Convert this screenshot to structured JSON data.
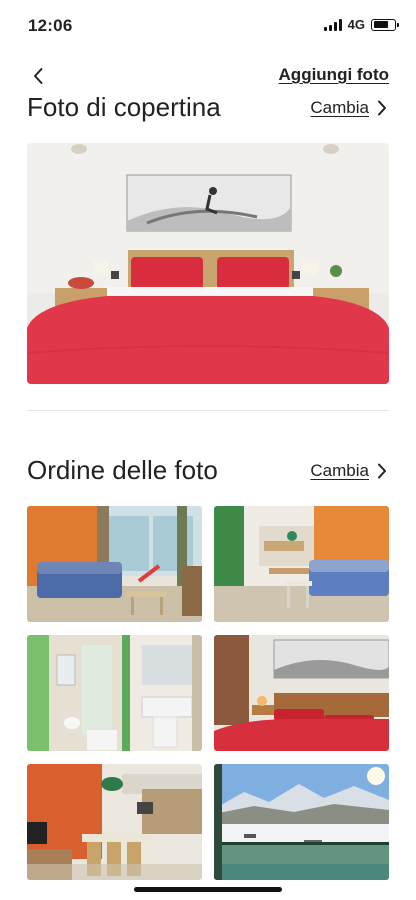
{
  "status_bar": {
    "time": "12:06",
    "network": "4G",
    "battery_level": 0.7,
    "signal_icon": "signal-bars-icon",
    "battery_icon": "battery-icon"
  },
  "nav": {
    "back_icon": "chevron-left-icon",
    "add_photo_label": "Aggiungi foto"
  },
  "cover_section": {
    "title": "Foto di copertina",
    "change_label": "Cambia",
    "change_icon": "chevron-right-icon",
    "photo_icon": "cover-photo-bedroom"
  },
  "order_section": {
    "title": "Ordine delle foto",
    "change_label": "Cambia",
    "change_icon": "chevron-right-icon",
    "photos": [
      {
        "subject": "living-room-sofa"
      },
      {
        "subject": "studio-sofa-kitchen"
      },
      {
        "subject": "bathroom"
      },
      {
        "subject": "bedroom-red"
      },
      {
        "subject": "kitchen-dining"
      },
      {
        "subject": "balcony-snow-view"
      }
    ]
  },
  "colors": {
    "text": "#222222",
    "divider": "#e4e4e4",
    "bed_red": "#e0384a",
    "orange_wall": "#e68a3a"
  }
}
